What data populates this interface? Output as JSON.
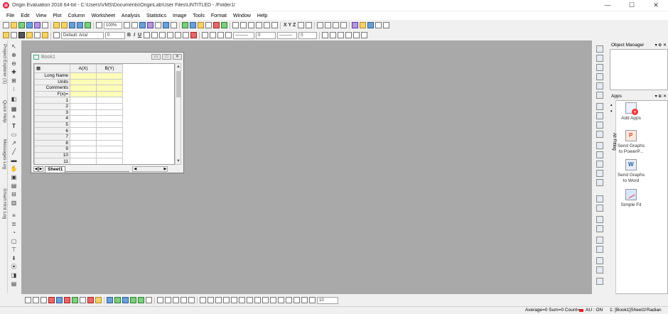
{
  "window": {
    "title": "Origin Evaluation 2018 64-bit - C:\\Users\\VMS\\Documents\\OriginLab\\User Files\\UNTITLED - /Folder1/",
    "controls": [
      "—",
      "☐",
      "✕"
    ]
  },
  "menu": [
    "File",
    "Edit",
    "View",
    "Plot",
    "Column",
    "Worksheet",
    "Analysis",
    "Statistics",
    "Image",
    "Tools",
    "Format",
    "Window",
    "Help"
  ],
  "toolbar": {
    "zoom": "100%",
    "font": "Default: Arial",
    "font_size": "0",
    "bold": "B",
    "italic": "I",
    "underline": "U",
    "line_width": "0",
    "xyz": "X  Y  Z"
  },
  "left_dock_tabs": [
    "Project Explorer (1)",
    "Quick Help",
    "Messages Log",
    "Smart Hint Log"
  ],
  "book": {
    "title": "Book1",
    "columns": [
      "A(X)",
      "B(Y)"
    ],
    "meta_rows": [
      "Long Name",
      "Units",
      "Comments",
      "F(x)="
    ],
    "rows": [
      "1",
      "2",
      "3",
      "4",
      "5",
      "6",
      "7",
      "8",
      "9",
      "10",
      "11"
    ],
    "sheet_tab": "Sheet1"
  },
  "object_manager": {
    "title": "Object Manager",
    "controls": "▾ ⊕ ✕"
  },
  "apps": {
    "title": "Apps",
    "controls": "▾ ⊕ ✕",
    "side_tab": "All  Fitting",
    "items": [
      {
        "label": "Add Apps",
        "icon": "add-apps-icon"
      },
      {
        "label": "Send Graphs to PowerP...",
        "icon": "powerpoint-icon"
      },
      {
        "label": "Send Graphs to Word",
        "icon": "word-icon"
      },
      {
        "label": "Simple Fit",
        "icon": "simple-fit-icon"
      }
    ]
  },
  "bottom_toolbar": {
    "size_value": "10"
  },
  "status": {
    "stats": "Average=0 Sum=0 Count=",
    "au": "AU : ON",
    "sheet": "1: [Book1]Sheet1!",
    "angle": "Radian"
  }
}
